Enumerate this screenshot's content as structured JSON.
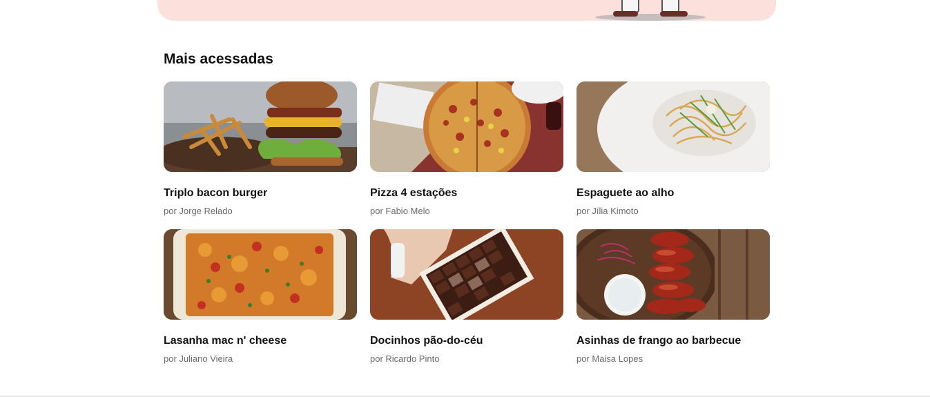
{
  "section": {
    "title": "Mais acessadas"
  },
  "recipes": [
    {
      "title": "Triplo bacon burger",
      "author": "por Jorge Relado",
      "image": "burger-photo"
    },
    {
      "title": "Pizza 4 estações",
      "author": "por Fabio Melo",
      "image": "pizza-photo"
    },
    {
      "title": "Espaguete ao alho",
      "author": "por Jília Kimoto",
      "image": "spaghetti-photo"
    },
    {
      "title": "Lasanha mac n' cheese",
      "author": "por Juliano Vieira",
      "image": "lasagna-photo"
    },
    {
      "title": "Docinhos pão-do-céu",
      "author": "por Ricardo Pinto",
      "image": "chocolates-photo"
    },
    {
      "title": "Asinhas de frango ao barbecue",
      "author": "por Maisa Lopes",
      "image": "chicken-wings-photo"
    }
  ],
  "colors": {
    "hero_background": "#fbe0dc",
    "title_text": "#111111",
    "author_text": "#6b6b6b"
  }
}
